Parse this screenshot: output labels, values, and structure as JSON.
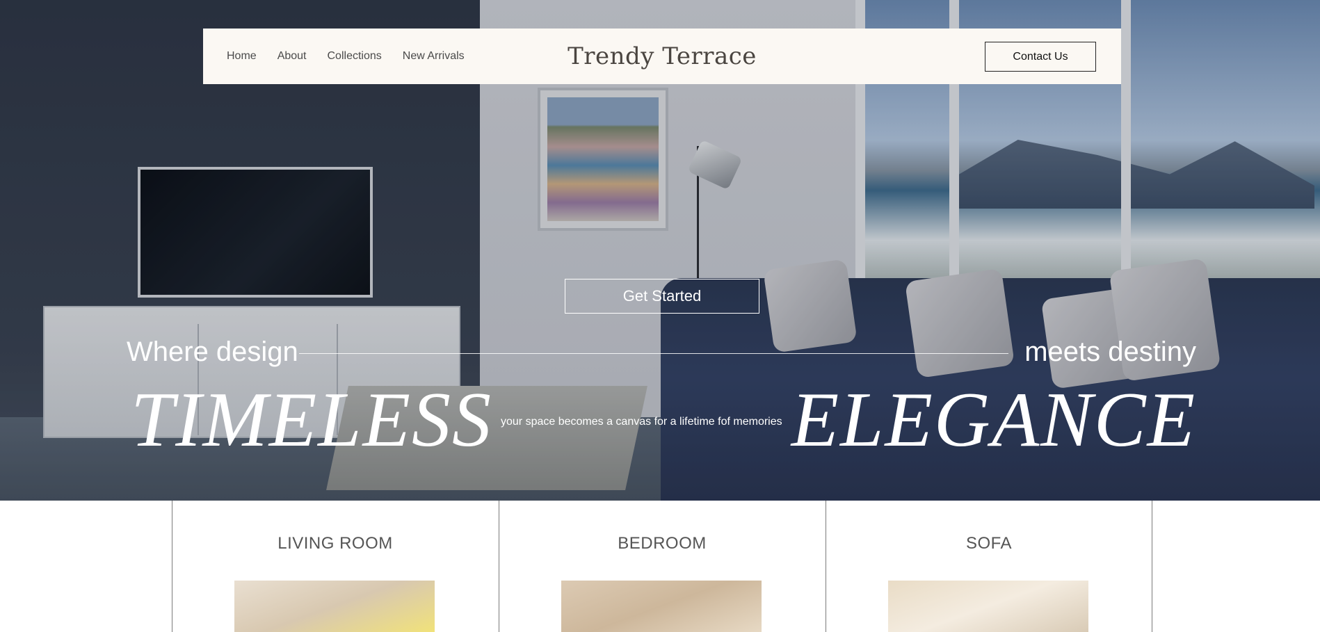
{
  "nav": {
    "links": [
      "Home",
      "About",
      "Collections",
      "New Arrivals"
    ],
    "brand": "Trendy Terrace",
    "contact_label": "Contact Us"
  },
  "hero": {
    "cta_label": "Get Started",
    "tag_left": "Where design",
    "tag_right": "meets destiny",
    "big_left": "TIMELESS",
    "big_right": "ELEGANCE",
    "tagline": "your space becomes a canvas for a lifetime fof memories"
  },
  "categories": [
    {
      "label": "LIVING ROOM",
      "thumb_colors": [
        "#e9dfd1",
        "#d8c8b0",
        "#f1e27a"
      ]
    },
    {
      "label": "BEDROOM",
      "thumb_colors": [
        "#dccab3",
        "#cdb79b",
        "#e7d9c4"
      ]
    },
    {
      "label": "SOFA",
      "thumb_colors": [
        "#e9dcc6",
        "#f4ece0",
        "#d9cbb6"
      ]
    }
  ],
  "colors": {
    "navbar_bg": "#fbf8f3",
    "text_dark": "#4a4a4a",
    "hero_text": "#ffffff"
  }
}
